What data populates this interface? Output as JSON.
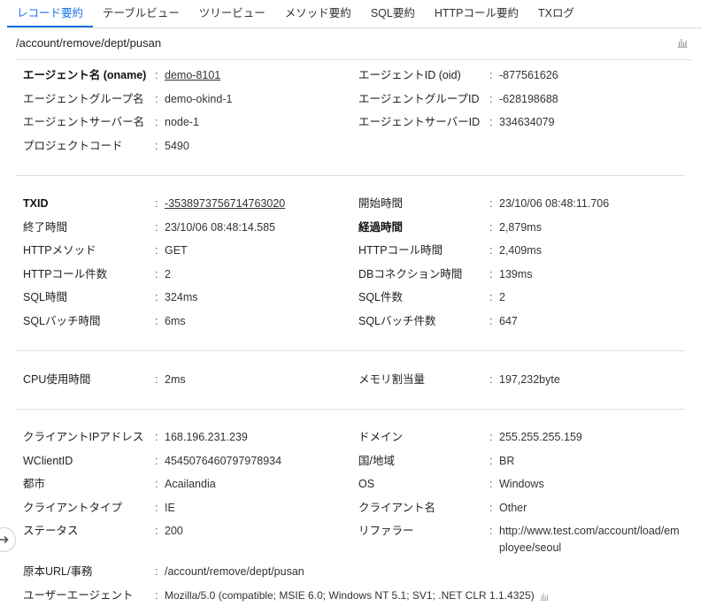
{
  "tabs": [
    {
      "label": "レコード要約",
      "active": true
    },
    {
      "label": "テーブルビュー",
      "active": false
    },
    {
      "label": "ツリービュー",
      "active": false
    },
    {
      "label": "メソッド要約",
      "active": false
    },
    {
      "label": "SQL要約",
      "active": false
    },
    {
      "label": "HTTPコール要約",
      "active": false
    },
    {
      "label": "TXログ",
      "active": false
    }
  ],
  "path": "/account/remove/dept/pusan",
  "colon": ":",
  "agent": {
    "oname_label": "エージェント名 (oname)",
    "oname_value": "demo-8101",
    "oid_label": "エージェントID (oid)",
    "oid_value": "-877561626",
    "group_label": "エージェントグループ名",
    "group_value": "demo-okind-1",
    "groupid_label": "エージェントグループID",
    "groupid_value": "-628198688",
    "server_label": "エージェントサーバー名",
    "server_value": "node-1",
    "serverid_label": "エージェントサーバーID",
    "serverid_value": "334634079",
    "project_label": "プロジェクトコード",
    "project_value": "5490"
  },
  "tx": {
    "txid_label": "TXID",
    "txid_value": "-3538973756714763020",
    "start_label": "開始時間",
    "start_value": "23/10/06 08:48:11.706",
    "end_label": "終了時間",
    "end_value": "23/10/06 08:48:14.585",
    "elapsed_label": "経過時間",
    "elapsed_value": "2,879ms",
    "method_label": "HTTPメソッド",
    "method_value": "GET",
    "httpcall_time_label": "HTTPコール時間",
    "httpcall_time_value": "2,409ms",
    "httpcall_count_label": "HTTPコール件数",
    "httpcall_count_value": "2",
    "dbconn_label": "DBコネクション時間",
    "dbconn_value": "139ms",
    "sql_time_label": "SQL時間",
    "sql_time_value": "324ms",
    "sql_count_label": "SQL件数",
    "sql_count_value": "2",
    "batch_time_label": "SQLバッチ時間",
    "batch_time_value": "6ms",
    "batch_count_label": "SQLバッチ件数",
    "batch_count_value": "647"
  },
  "resource": {
    "cpu_label": "CPU使用時間",
    "cpu_value": "2ms",
    "mem_label": "メモリ割当量",
    "mem_value": "197,232byte"
  },
  "client": {
    "ip_label": "クライアントIPアドレス",
    "ip_value": "168.196.231.239",
    "domain_label": "ドメイン",
    "domain_value": "255.255.255.159",
    "wclient_label": "WClientID",
    "wclient_value": "4545076460797978934",
    "country_label": "国/地域",
    "country_value": "BR",
    "city_label": "都市",
    "city_value": "Acailandia",
    "os_label": "OS",
    "os_value": "Windows",
    "type_label": "クライアントタイプ",
    "type_value": "IE",
    "name_label": "クライアント名",
    "name_value": "Other",
    "status_label": "ステータス",
    "status_value": "200",
    "referer_label": "リファラー",
    "referer_line1": "http://www.test.com/account/load/em",
    "referer_line2": "ployee/seoul",
    "url_label": "原本URL/事務",
    "url_value": "/account/remove/dept/pusan",
    "ua_label": "ユーザーエージェント",
    "ua_value": "Mozilla/5.0 (compatible; MSIE 6.0; Windows NT 5.1; SV1; .NET CLR 1.1.4325)"
  },
  "colors": {
    "accent": "#1a73e8"
  }
}
